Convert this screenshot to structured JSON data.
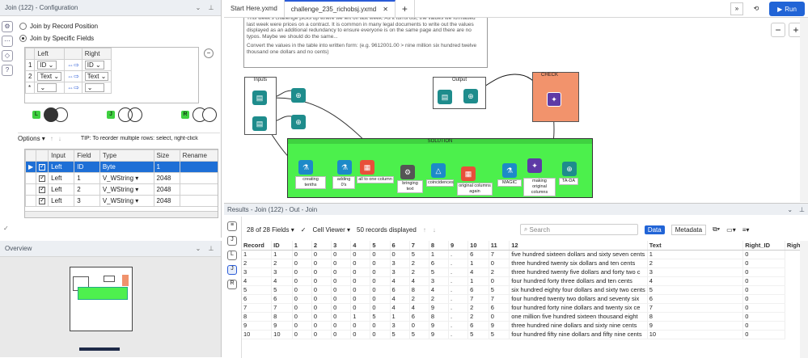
{
  "config": {
    "title": "Join (122) - Configuration",
    "join_by_position": "Join by Record Position",
    "join_by_fields": "Join by Specific Fields",
    "left_header": "Left",
    "right_header": "Right",
    "join_rows": [
      {
        "num": "1",
        "left": "ID",
        "right": "ID"
      },
      {
        "num": "2",
        "left": "Text",
        "right": "Text"
      },
      {
        "num": "*",
        "left": "",
        "right": ""
      }
    ],
    "venn_labels": [
      "L",
      "J",
      "R"
    ],
    "options_label": "Options",
    "tip": "TIP: To reorder multiple rows: select, right-click",
    "field_columns": [
      "Input",
      "Field",
      "Type",
      "Size",
      "Rename"
    ],
    "fields": [
      {
        "input": "Left",
        "field": "ID",
        "type": "Byte",
        "size": "1"
      },
      {
        "input": "Left",
        "field": "1",
        "type": "V_WString",
        "size": "2048"
      },
      {
        "input": "Left",
        "field": "2",
        "type": "V_WString",
        "size": "2048"
      },
      {
        "input": "Left",
        "field": "3",
        "type": "V_WString",
        "size": "2048"
      }
    ]
  },
  "overview": {
    "title": "Overview"
  },
  "tabs": [
    {
      "label": "Start Here.yxmd"
    },
    {
      "label": "challenge_235_richobsj.yxmd"
    }
  ],
  "run_label": "Run",
  "canvas": {
    "note_text": "This week's challenge picks up where we left off last week. As it turns out, the values we formatted last week were prices on a contract. It is common in many legal documents to write out the values displayed as an additional redundancy to ensure everyone is on the same page and there are no typos. Maybe we should do the same...",
    "note_text2": "Convert the values in the table into written form: (e.g. 9612001.00 > nine million six hundred twelve thousand one dollars and no cents)",
    "input_label": "Inputs",
    "output_label": "Output",
    "check_label": "CHECK",
    "solution_label": "SOLUTION",
    "tool_labels": [
      "creating tenths",
      "adding 0's",
      "all to one column",
      "bringing text",
      "coincidences",
      "original columns again",
      "MAGIC",
      "making original columns",
      "TA-DA"
    ]
  },
  "results": {
    "title": "Results - Join (122) - Out - Join",
    "fields_count": "28 of 28 Fields",
    "viewer": "Cell Viewer",
    "records": "50 records displayed",
    "search_placeholder": "Search",
    "data_btn": "Data",
    "metadata_btn": "Metadata",
    "columns": [
      "Record",
      "ID",
      "1",
      "2",
      "3",
      "4",
      "5",
      "6",
      "7",
      "8",
      "9",
      "10",
      "11",
      "12",
      "Text",
      "Right_ID",
      "Right"
    ],
    "rows": [
      [
        "1",
        "1",
        "0",
        "0",
        "0",
        "0",
        "0",
        "0",
        "5",
        "1",
        ".",
        "6",
        "7",
        "five hundred sixteen dollars and sixty seven cents",
        "1",
        "0"
      ],
      [
        "2",
        "2",
        "0",
        "0",
        "0",
        "0",
        "0",
        "3",
        "2",
        "6",
        ".",
        "1",
        "0",
        "three hundred twenty six dollars and ten cents",
        "2",
        "0"
      ],
      [
        "3",
        "3",
        "0",
        "0",
        "0",
        "0",
        "0",
        "3",
        "2",
        "5",
        ".",
        "4",
        "2",
        "three hundred twenty five dollars and forty two c",
        "3",
        "0"
      ],
      [
        "4",
        "4",
        "0",
        "0",
        "0",
        "0",
        "0",
        "4",
        "4",
        "3",
        ".",
        "1",
        "0",
        "four hundred forty three dollars and ten cents",
        "4",
        "0"
      ],
      [
        "5",
        "5",
        "0",
        "0",
        "0",
        "0",
        "0",
        "6",
        "8",
        "4",
        ".",
        "6",
        "5",
        "six hundred eighty four dollars and sixty two cents",
        "5",
        "0"
      ],
      [
        "6",
        "6",
        "0",
        "0",
        "0",
        "0",
        "0",
        "4",
        "2",
        "2",
        ".",
        "7",
        "7",
        "four hundred twenty two dollars and seventy six",
        "6",
        "0"
      ],
      [
        "7",
        "7",
        "0",
        "0",
        "0",
        "0",
        "0",
        "4",
        "4",
        "9",
        ".",
        "2",
        "6",
        "four hundred forty nine dollars and twenty six ce",
        "7",
        "0"
      ],
      [
        "8",
        "8",
        "0",
        "0",
        "0",
        "1",
        "5",
        "1",
        "6",
        "8",
        ".",
        "2",
        "0",
        "one million five hundred sixteen thousand eight",
        "8",
        "0"
      ],
      [
        "9",
        "9",
        "0",
        "0",
        "0",
        "0",
        "0",
        "3",
        "0",
        "9",
        ".",
        "6",
        "9",
        "three hundred nine dollars and sixty nine cents",
        "9",
        "0"
      ],
      [
        "10",
        "10",
        "0",
        "0",
        "0",
        "0",
        "0",
        "5",
        "5",
        "9",
        ".",
        "5",
        "5",
        "four hundred fifty nine dollars and fifty nine cents",
        "10",
        "0"
      ]
    ]
  }
}
